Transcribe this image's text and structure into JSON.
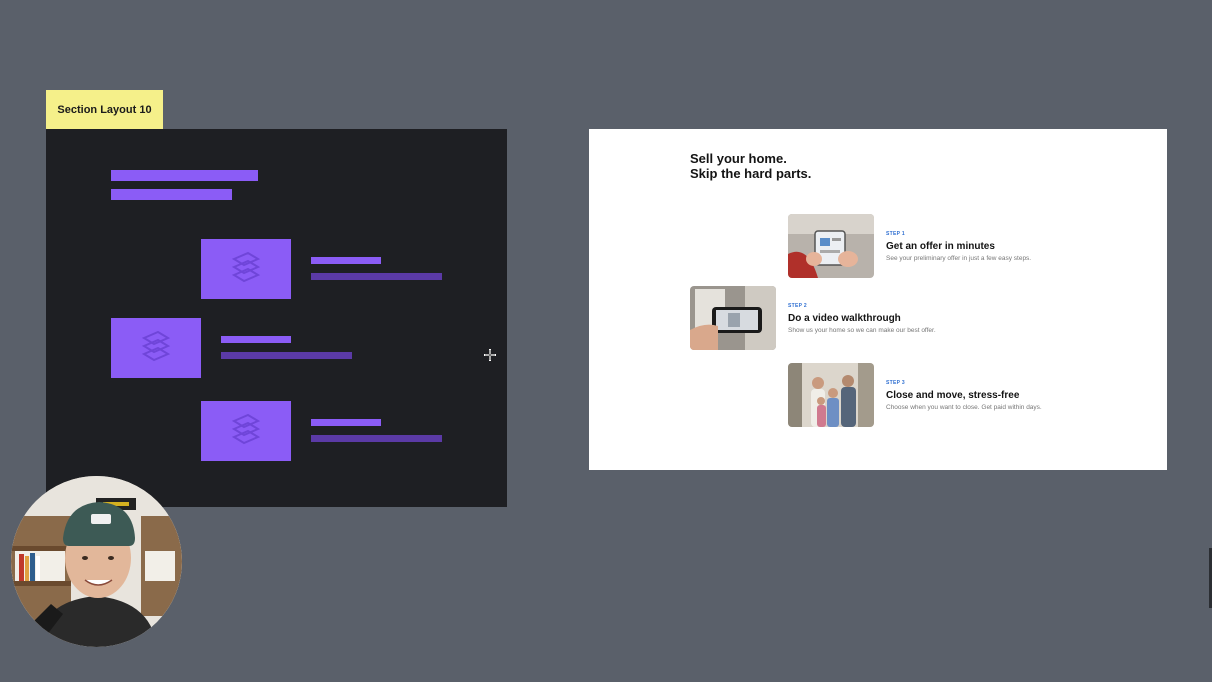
{
  "section_label": "Section Layout 10",
  "wireframe": {
    "accent_color": "#8b5cf6",
    "dim_color": "#5b3aa6",
    "background": "#1e1f23",
    "image_icon": "image-placeholder-icon"
  },
  "preview": {
    "headline_line1": "Sell your home.",
    "headline_line2": "Skip the hard parts.",
    "steps": [
      {
        "number": "STEP 1",
        "title": "Get an offer in minutes",
        "description": "See your preliminary offer in just a few easy steps."
      },
      {
        "number": "STEP 2",
        "title": "Do a video walkthrough",
        "description": "Show us your home so we can make our best offer."
      },
      {
        "number": "STEP 3",
        "title": "Close and move, stress-free",
        "description": "Choose when you want to close. Get paid within days."
      }
    ],
    "accent_color": "#2f6fd1"
  },
  "cursor_icon": "crosshair-icon",
  "webcam_icon": "presenter-webcam"
}
